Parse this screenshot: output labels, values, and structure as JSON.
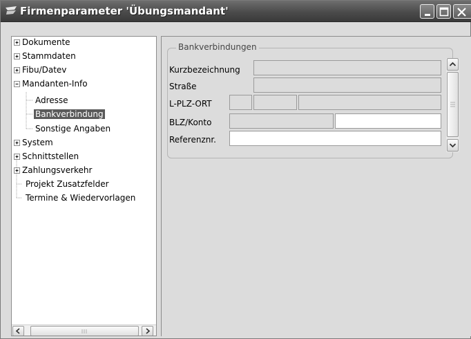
{
  "window": {
    "title": "Firmenparameter 'Übungsmandant'"
  },
  "tree": {
    "items": [
      {
        "label": "Dokumente",
        "expander": "plus",
        "selected": false
      },
      {
        "label": "Stammdaten",
        "expander": "plus",
        "selected": false
      },
      {
        "label": "Fibu/Datev",
        "expander": "plus",
        "selected": false
      },
      {
        "label": "Mandanten-Info",
        "expander": "minus",
        "selected": false
      },
      {
        "label": "Adresse",
        "expander": "none",
        "selected": false
      },
      {
        "label": "Bankverbindung",
        "expander": "none",
        "selected": true
      },
      {
        "label": "Sonstige Angaben",
        "expander": "none",
        "selected": false
      },
      {
        "label": "System",
        "expander": "plus",
        "selected": false
      },
      {
        "label": "Schnittstellen",
        "expander": "plus",
        "selected": false
      },
      {
        "label": "Zahlungsverkehr",
        "expander": "plus",
        "selected": false
      },
      {
        "label": "Projekt Zusatzfelder",
        "expander": "none",
        "selected": false
      },
      {
        "label": "Termine & Wiedervorlagen",
        "expander": "none",
        "selected": false
      }
    ]
  },
  "bank": {
    "group_title": "Bankverbindungen",
    "labels": {
      "kurzbezeichnung": "Kurzbezeichnung",
      "strasse": "Straße",
      "lplzort": "L-PLZ-ORT",
      "blzkonto": "BLZ/Konto",
      "referenz": "Referenznr."
    },
    "values": {
      "kurzbezeichnung": "",
      "strasse": "",
      "land": "",
      "plz": "",
      "ort": "",
      "blz": "",
      "konto": "",
      "referenz": ""
    }
  },
  "icons": {
    "app": "app-logo-icon",
    "minimize": "minimize-icon",
    "maximize": "maximize-icon",
    "close": "close-icon",
    "scroll_left": "arrow-left-icon",
    "scroll_right": "arrow-right-icon",
    "scroll_up": "arrow-up-icon",
    "scroll_down": "arrow-down-icon"
  },
  "colors": {
    "titlebar": "#4b4b4b",
    "selection": "#5a5a5a",
    "window_bg": "#dcdcdc"
  }
}
